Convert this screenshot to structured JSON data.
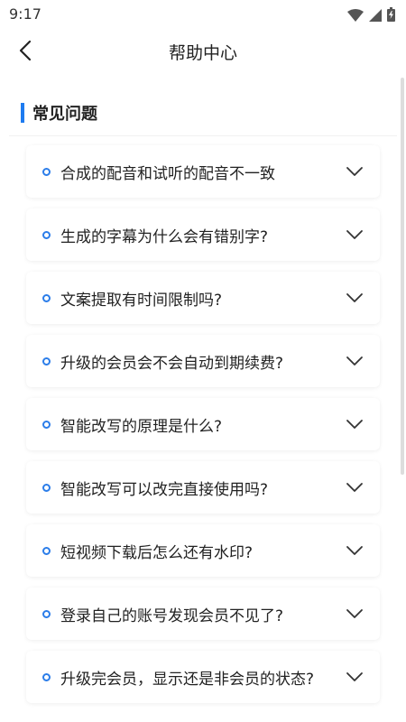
{
  "status_bar": {
    "time": "9:17",
    "icons": [
      "wifi-icon",
      "signal-icon",
      "battery-icon"
    ]
  },
  "header": {
    "title": "帮助中心",
    "back_icon": "chevron-left-icon"
  },
  "section": {
    "title": "常见问题",
    "accent_color": "#1e7bf0"
  },
  "faq_items": [
    {
      "question": "合成的配音和试听的配音不一致"
    },
    {
      "question": "生成的字幕为什么会有错别字?"
    },
    {
      "question": "文案提取有时间限制吗?"
    },
    {
      "question": "升级的会员会不会自动到期续费?"
    },
    {
      "question": "智能改写的原理是什么?"
    },
    {
      "question": "智能改写可以改完直接使用吗?"
    },
    {
      "question": "短视频下载后怎么还有水印?"
    },
    {
      "question": "登录自己的账号发现会员不见了?"
    },
    {
      "question": "升级完会员，显示还是非会员的状态?"
    }
  ]
}
